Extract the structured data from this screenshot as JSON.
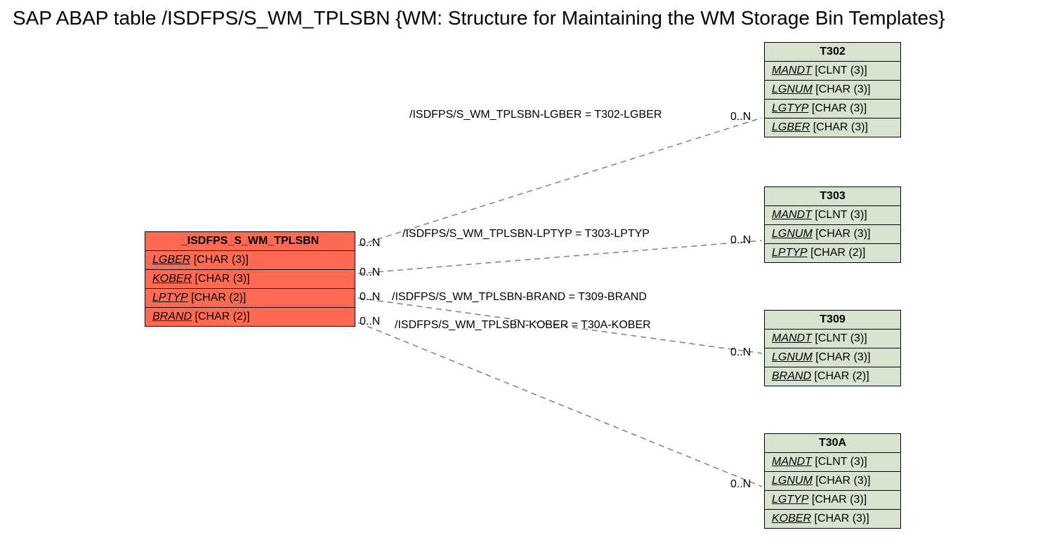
{
  "title": "SAP ABAP table /ISDFPS/S_WM_TPLSBN {WM: Structure for Maintaining the WM Storage Bin Templates}",
  "main": {
    "name": "_ISDFPS_S_WM_TPLSBN",
    "fields": [
      {
        "name": "LGBER",
        "type": "[CHAR (3)]"
      },
      {
        "name": "KOBER",
        "type": "[CHAR (3)]"
      },
      {
        "name": "LPTYP",
        "type": "[CHAR (2)]"
      },
      {
        "name": "BRAND",
        "type": "[CHAR (2)]"
      }
    ]
  },
  "refs": {
    "t302": {
      "name": "T302",
      "fields": [
        {
          "name": "MANDT",
          "type": "[CLNT (3)]"
        },
        {
          "name": "LGNUM",
          "type": "[CHAR (3)]"
        },
        {
          "name": "LGTYP",
          "type": "[CHAR (3)]"
        },
        {
          "name": "LGBER",
          "type": "[CHAR (3)]"
        }
      ]
    },
    "t303": {
      "name": "T303",
      "fields": [
        {
          "name": "MANDT",
          "type": "[CLNT (3)]"
        },
        {
          "name": "LGNUM",
          "type": "[CHAR (3)]"
        },
        {
          "name": "LPTYP",
          "type": "[CHAR (2)]"
        }
      ]
    },
    "t309": {
      "name": "T309",
      "fields": [
        {
          "name": "MANDT",
          "type": "[CLNT (3)]"
        },
        {
          "name": "LGNUM",
          "type": "[CHAR (3)]"
        },
        {
          "name": "BRAND",
          "type": "[CHAR (2)]"
        }
      ]
    },
    "t30a": {
      "name": "T30A",
      "fields": [
        {
          "name": "MANDT",
          "type": "[CLNT (3)]"
        },
        {
          "name": "LGNUM",
          "type": "[CHAR (3)]"
        },
        {
          "name": "LGTYP",
          "type": "[CHAR (3)]"
        },
        {
          "name": "KOBER",
          "type": "[CHAR (3)]"
        }
      ]
    }
  },
  "relations": {
    "r1": {
      "text": "/ISDFPS/S_WM_TPLSBN-LGBER = T302-LGBER",
      "leftCard": "0..N",
      "rightCard": "0..N"
    },
    "r2": {
      "text": "/ISDFPS/S_WM_TPLSBN-LPTYP = T303-LPTYP",
      "leftCard": "0..N",
      "rightCard": "0..N"
    },
    "r3": {
      "text": "/ISDFPS/S_WM_TPLSBN-BRAND = T309-BRAND",
      "leftCard": "0..N",
      "rightCard": "0..N"
    },
    "r4": {
      "text": "/ISDFPS/S_WM_TPLSBN-KOBER = T30A-KOBER",
      "leftCard": "0..N",
      "rightCard": "0..N"
    }
  }
}
